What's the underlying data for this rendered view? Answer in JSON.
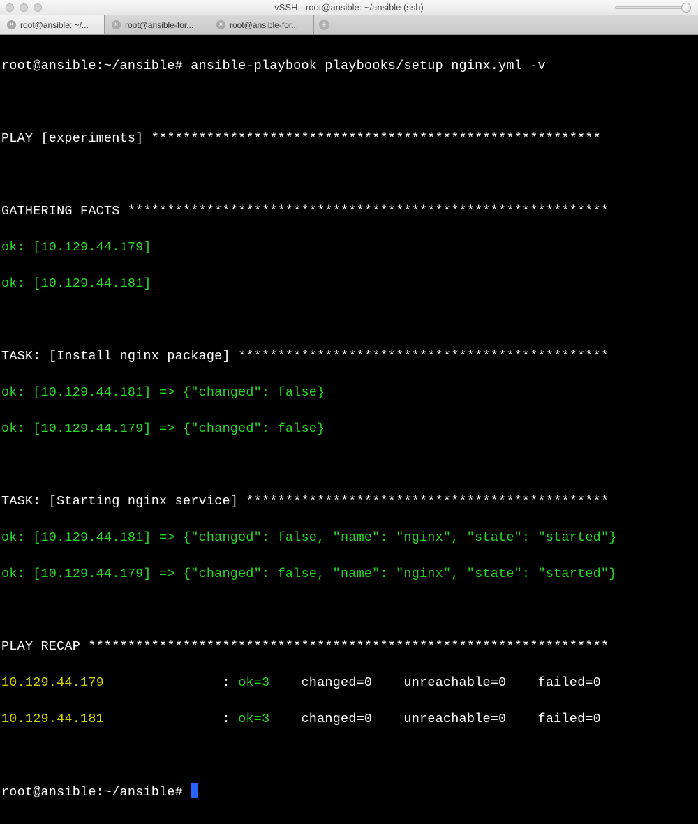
{
  "window": {
    "title": "vSSH - root@ansible: ~/ansible (ssh)"
  },
  "tabs": [
    {
      "label": "root@ansible: ~/...",
      "active": true
    },
    {
      "label": "root@ansible-for...",
      "active": false
    },
    {
      "label": "root@ansible-for...",
      "active": false
    }
  ],
  "terminal": {
    "prompt1": "root@ansible:~/ansible# ",
    "command1": "ansible-playbook playbooks/setup_nginx.yml -v",
    "play_header": "PLAY [experiments] ",
    "play_stars": "*********************************************************",
    "gather_header": "GATHERING FACTS ",
    "gather_stars": "*************************************************************",
    "gather_lines": [
      "ok: [10.129.44.179]",
      "ok: [10.129.44.181]"
    ],
    "task1_header": "TASK: [Install nginx package] ",
    "task1_stars": "***********************************************",
    "task1_lines": [
      "ok: [10.129.44.181] => {\"changed\": false}",
      "ok: [10.129.44.179] => {\"changed\": false}"
    ],
    "task2_header": "TASK: [Starting nginx service] ",
    "task2_stars": "**********************************************",
    "task2_lines": [
      "ok: [10.129.44.181] => {\"changed\": false, \"name\": \"nginx\", \"state\": \"started\"}",
      "ok: [10.129.44.179] => {\"changed\": false, \"name\": \"nginx\", \"state\": \"started\"}"
    ],
    "recap_header": "PLAY RECAP ",
    "recap_stars": "******************************************************************",
    "recap": [
      {
        "host": "10.129.44.179",
        "colon": "               : ",
        "ok": "ok=3",
        "rest": "    changed=0    unreachable=0    failed=0"
      },
      {
        "host": "10.129.44.181",
        "colon": "               : ",
        "ok": "ok=3",
        "rest": "    changed=0    unreachable=0    failed=0"
      }
    ],
    "prompt2": "root@ansible:~/ansible# "
  }
}
